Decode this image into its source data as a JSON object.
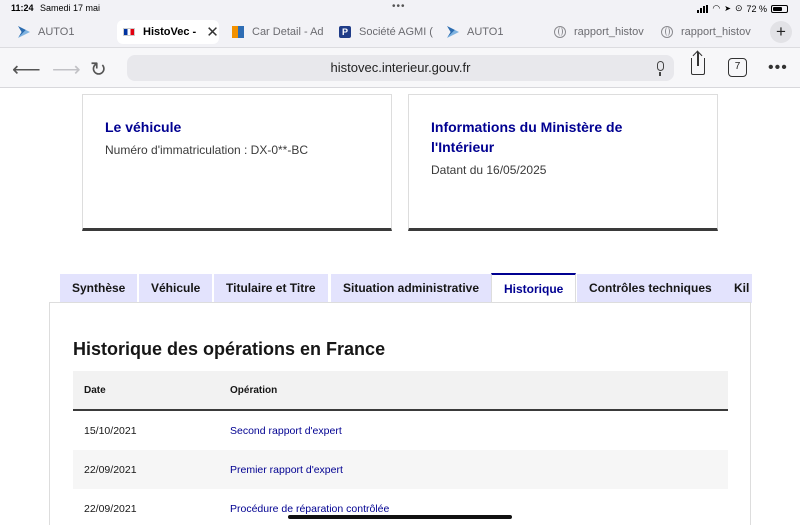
{
  "status_bar": {
    "time": "11:24",
    "date": "Samedi 17 mai",
    "battery": "72 %",
    "battery_level": 0.72
  },
  "browser_tabs": [
    {
      "label": "AUTO1",
      "icon": "auto1-icon",
      "active": false
    },
    {
      "label": "HistoVec -",
      "icon": "french-flag-icon",
      "active": true
    },
    {
      "label": "Car Detail - Ad",
      "icon": "car-detail-icon",
      "active": false
    },
    {
      "label": "Société AGMI (",
      "icon": "p-icon",
      "active": false
    },
    {
      "label": "AUTO1",
      "icon": "auto1-icon",
      "active": false
    },
    {
      "label": "rapport_histov",
      "icon": "globe-icon",
      "active": false
    },
    {
      "label": "rapport_histov",
      "icon": "globe-icon",
      "active": false
    }
  ],
  "address_bar": {
    "url": "histovec.interieur.gouv.fr",
    "tab_count": "7"
  },
  "cards": {
    "vehicle": {
      "title": "Le véhicule",
      "text": "Numéro d'immatriculation : DX-0**-BC"
    },
    "ministry": {
      "title_line1": "Informations du Ministère de",
      "title_line2": "l'Intérieur",
      "text": "Datant du 16/05/2025"
    }
  },
  "content_tabs": [
    {
      "label": "Synthèse",
      "selected": false
    },
    {
      "label": "Véhicule",
      "selected": false
    },
    {
      "label": "Titulaire et Titre",
      "selected": false
    },
    {
      "label": "Situation administrative",
      "selected": false
    },
    {
      "label": "Historique",
      "selected": true
    },
    {
      "label": "Contrôles techniques",
      "selected": false
    },
    {
      "label": "Kil",
      "selected": false
    }
  ],
  "history": {
    "heading": "Historique des opérations en France",
    "columns": {
      "date": "Date",
      "operation": "Opération"
    },
    "rows": [
      {
        "date": "15/10/2021",
        "operation": "Second rapport d'expert"
      },
      {
        "date": "22/09/2021",
        "operation": "Premier rapport d'expert"
      },
      {
        "date": "22/09/2021",
        "operation": "Procédure de réparation contrôlée"
      }
    ]
  },
  "colors": {
    "accent_blue": "#000091",
    "tab_background": "#e3e3fd"
  }
}
